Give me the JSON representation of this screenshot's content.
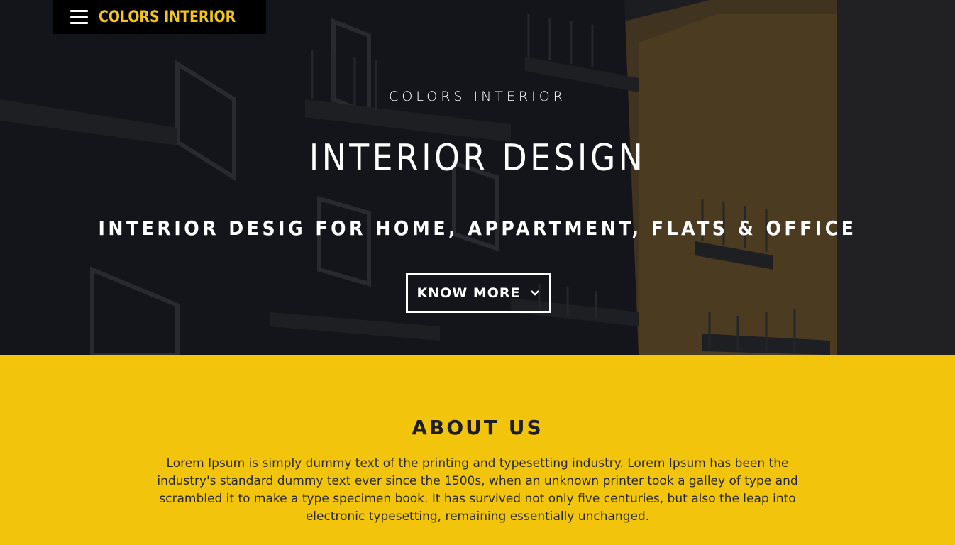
{
  "header": {
    "brand": "COLORS INTERIOR",
    "menu_icon": "hamburger-menu-icon"
  },
  "hero": {
    "eyebrow": "COLORS INTERIOR",
    "headline": "INTERIOR DESIGN",
    "subhead": "INTERIOR DESIG FOR HOME, APPARTMENT, FLATS & OFFICE",
    "cta_label": "KNOW MORE",
    "cta_icon": "chevron-down-icon"
  },
  "about": {
    "title": "ABOUT US",
    "body": "Lorem Ipsum is simply dummy text of the printing and typesetting industry. Lorem Ipsum has been the industry's standard dummy text ever since the 1500s, when an unknown printer took a galley of type and scrambled it to make a type specimen book. It has survived not only five centuries, but also the leap into electronic typesetting, remaining essentially unchanged."
  },
  "colors": {
    "accent": "#f5c518",
    "about_bg": "#f2c40b",
    "hero_dark": "#1d1f24"
  }
}
